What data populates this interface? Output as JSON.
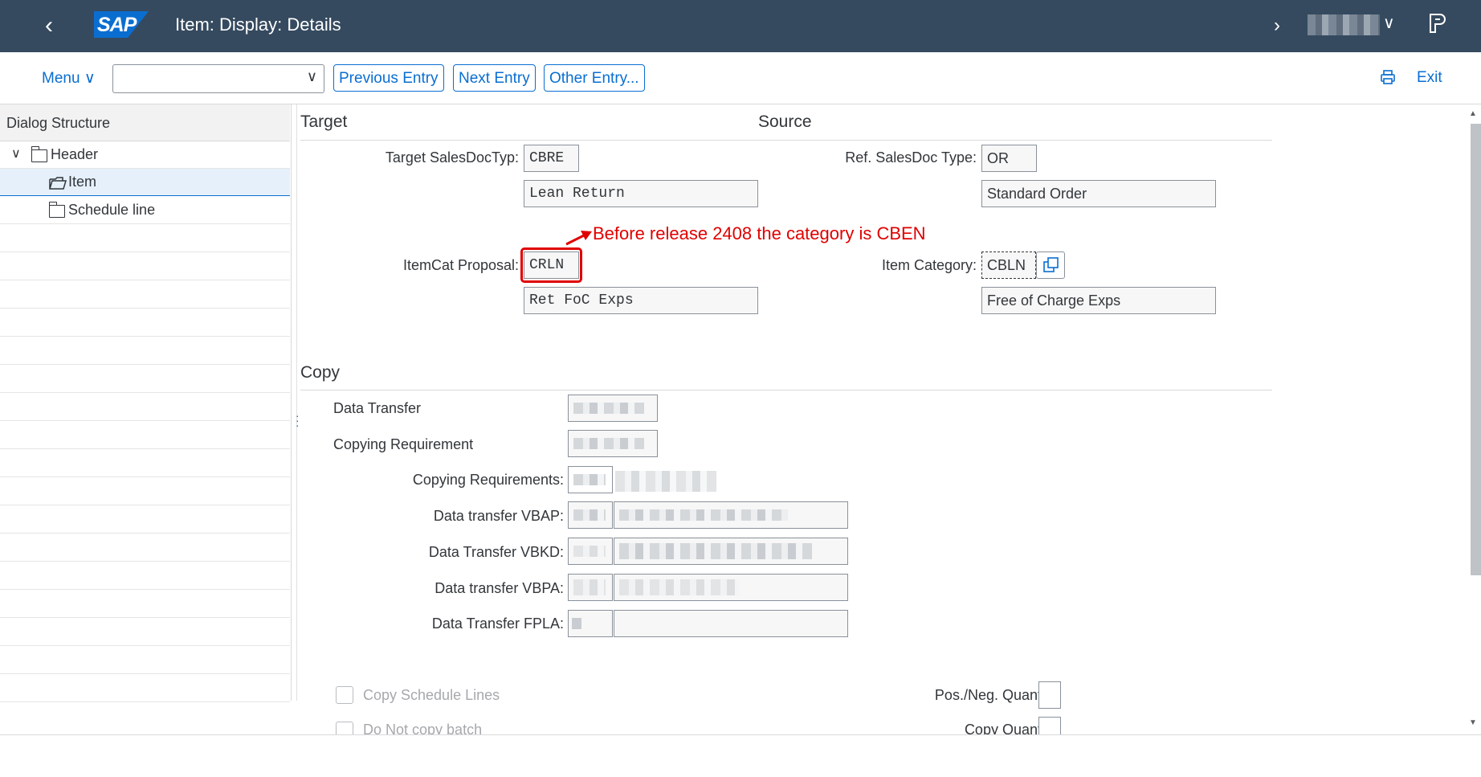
{
  "shell": {
    "title": "Item: Display: Details",
    "logo_text": "SAP",
    "icons": {
      "back": "back-arrow-icon",
      "forward": "chevron-right-icon",
      "user_menu": "chevron-down-icon",
      "product": "product-switch-icon"
    }
  },
  "toolbar": {
    "menu_label": "Menu",
    "command_value": "",
    "buttons": [
      "Previous Entry",
      "Next Entry",
      "Other Entry..."
    ],
    "exit_label": "Exit",
    "print_icon": "print-icon"
  },
  "dialog_structure": {
    "title": "Dialog Structure",
    "items": [
      {
        "label": "Header",
        "expanded": true,
        "selected": false
      },
      {
        "label": "Item",
        "expanded": false,
        "selected": true
      },
      {
        "label": "Schedule line",
        "expanded": false,
        "selected": false
      }
    ]
  },
  "target": {
    "section_title": "Target",
    "sales_doc_type_label": "Target SalesDocTyp:",
    "sales_doc_type_value": "CBRE",
    "sales_doc_type_desc": "Lean Return",
    "itemcat_label": "ItemCat Proposal:",
    "itemcat_value": "CRLN",
    "itemcat_desc": "Ret FoC Exps"
  },
  "source": {
    "section_title": "Source",
    "ref_doc_type_label": "Ref. SalesDoc Type:",
    "ref_doc_type_value": "OR",
    "ref_doc_type_desc": "Standard Order",
    "item_category_label": "Item Category:",
    "item_category_value": "CBLN",
    "item_category_desc": "Free of Charge Exps",
    "copy_icon": "copy-icon"
  },
  "annotation": {
    "text": "Before release 2408 the category is CBEN",
    "color": "#e00000"
  },
  "copy": {
    "section_title": "Copy",
    "data_transfer_label": "Data Transfer",
    "copying_requirement_label": "Copying Requirement",
    "copying_requirements_label": "Copying Requirements:",
    "vbap_label": "Data transfer VBAP:",
    "vbkd_label": "Data Transfer VBKD:",
    "vbpa_label": "Data transfer VBPA:",
    "fpla_label": "Data Transfer FPLA:",
    "copy_schedule_lines_label": "Copy Schedule Lines",
    "do_not_copy_batch_label": "Do Not copy batch",
    "pos_neg_qty_label": "Pos./Neg. Quantity:",
    "copy_qty_label": "Copy Quantity:"
  },
  "colors": {
    "shell": "#354a5f",
    "accent": "#0a6ed1",
    "highlight": "#e00000"
  }
}
